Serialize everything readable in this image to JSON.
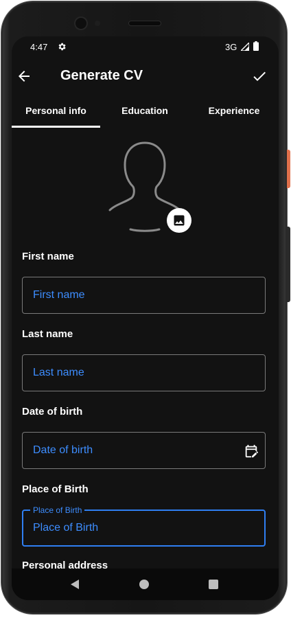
{
  "status_bar": {
    "time": "4:47",
    "network": "3G"
  },
  "app_bar": {
    "title": "Generate CV"
  },
  "tabs": [
    {
      "label": "Personal info",
      "selected": true
    },
    {
      "label": "Education",
      "selected": false
    },
    {
      "label": "Experience",
      "selected": false
    }
  ],
  "form": {
    "first_name": {
      "label": "First name",
      "placeholder": "First name"
    },
    "last_name": {
      "label": "Last name",
      "placeholder": "Last name"
    },
    "date_of_birth": {
      "label": "Date of birth",
      "placeholder": "Date of birth"
    },
    "place_of_birth": {
      "label": "Place of Birth",
      "floating_label": "Place of Birth",
      "placeholder": "Place of Birth"
    },
    "personal_address": {
      "label": "Personal address"
    }
  },
  "colors": {
    "background": "#121212",
    "accent": "#2f7ff3",
    "placeholder": "#3d8dff",
    "text": "#ffffff"
  },
  "icons": [
    "settings-gear-icon",
    "signal-icon",
    "battery-icon",
    "back-arrow-icon",
    "checkmark-icon",
    "avatar-silhouette-icon",
    "image-icon",
    "calendar-edit-icon",
    "nav-back-icon",
    "nav-home-icon",
    "nav-recents-icon"
  ]
}
